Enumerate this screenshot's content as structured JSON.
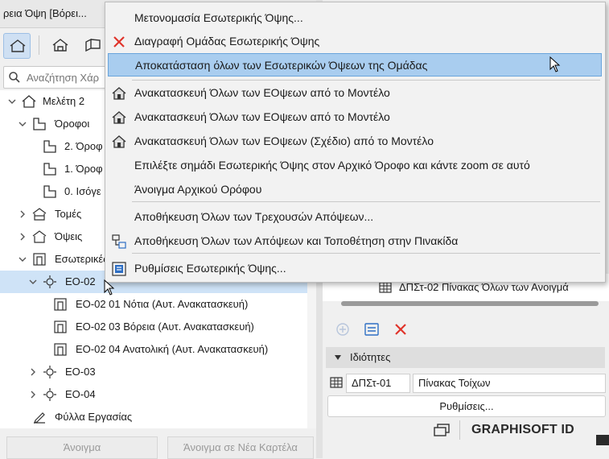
{
  "window": {
    "title": "ρεια Όψη [Βόρει..."
  },
  "search": {
    "placeholder": "Αναζήτηση Χάρ"
  },
  "tree": {
    "items": [
      {
        "label": "Μελέτη 2"
      },
      {
        "label": "Όροφοι"
      },
      {
        "label": "2. Όροφ"
      },
      {
        "label": "1. Όροφ"
      },
      {
        "label": "0. Ισόγε"
      },
      {
        "label": "Τομές"
      },
      {
        "label": "Όψεις"
      },
      {
        "label": "Εσωτερικές"
      },
      {
        "label": "ΕΟ-02"
      },
      {
        "label": "ΕΟ-02 01 Νότια (Αυτ. Ανακατασκευή)"
      },
      {
        "label": "ΕΟ-02 03 Βόρεια (Αυτ. Ανακατασκευή)"
      },
      {
        "label": "ΕΟ-02 04 Ανατολική (Αυτ. Ανακατασκευή)"
      },
      {
        "label": "ΕΟ-03"
      },
      {
        "label": "ΕΟ-04"
      },
      {
        "label": "Φύλλα Εργασίας"
      }
    ]
  },
  "bottom_buttons": {
    "open": "Άνοιγμα",
    "open_new_tab": "Άνοιγμα σε Νέα Καρτέλα"
  },
  "context_menu": {
    "items": [
      {
        "label": "Μετονομασία Εσωτερικής Όψης..."
      },
      {
        "label": "Διαγραφή Ομάδας Εσωτερικής Όψης",
        "icon": "delete-x-icon"
      },
      {
        "label": "Αποκατάσταση όλων των Εσωτερικών Όψεων της Ομάδας",
        "highlighted": true
      },
      {
        "label": "Ανακατασκευή Όλων των ΕΟψεων από το Μοντέλο",
        "icon": "rebuild-icon"
      },
      {
        "label": "Ανακατασκευή Όλων των ΕΟψεων από το Μοντέλο",
        "icon": "rebuild-icon"
      },
      {
        "label": "Ανακατασκευή Όλων των ΕΟψεων (Σχέδιο) από το Μοντέλο",
        "icon": "rebuild-icon"
      },
      {
        "label": "Επιλέξτε σημάδι Εσωτερικής Όψης στον Αρχικό Όροφο και κάντε zoom σε αυτό"
      },
      {
        "label": "Άνοιγμα Αρχικού Ορόφου"
      },
      {
        "label": "Αποθήκευση Όλων των Τρεχουσών Απόψεων..."
      },
      {
        "label": "Αποθήκευση Όλων των Απόψεων και Τοποθέτηση στην Πινακίδα",
        "icon": "save-place-icon"
      },
      {
        "label": "Ρυθμίσεις Εσωτερικής Όψης...",
        "icon": "settings-icon"
      }
    ]
  },
  "right_panel": {
    "layout_item": "ΔΠΣτ-02 Πίνακας Όλων των Ανοιγμά",
    "properties_label": "Ιδιότητες",
    "id_value": "ΔΠΣτ-01",
    "name_value": "Πίνακας Τοίχων",
    "settings_button": "Ρυθμίσεις...",
    "brand": "GRAPHISOFT ID"
  },
  "colors": {
    "highlight": "#a9cdef",
    "selection": "#cfe3f7",
    "delete_red": "#e0342b",
    "accent_blue": "#3a7bd5"
  }
}
